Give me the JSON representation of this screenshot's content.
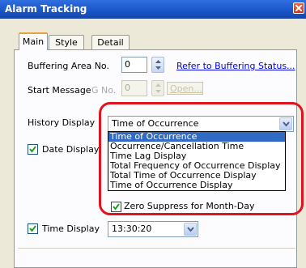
{
  "window": {
    "title": "Alarm Tracking"
  },
  "tabs": [
    {
      "label": "Main",
      "active": true
    },
    {
      "label": "Style",
      "active": false
    },
    {
      "label": "Detail",
      "active": false
    }
  ],
  "buffering": {
    "label": "Buffering Area No.",
    "value": "0",
    "link": "Refer to Buffering Status..."
  },
  "start_message": {
    "label": "Start Message",
    "gno_label": "G No.",
    "value": "0",
    "open_label": "Open..."
  },
  "history": {
    "label": "History Display",
    "selected": "Time of Occurrence",
    "options": [
      "Time of Occurrence",
      "Occurrence/Cancellation Time",
      "Time Lag Display",
      "Total Frequency of Occurrence Display",
      "Total Time of Occurrence Display",
      "Time of Occurrence Display"
    ]
  },
  "date_display": {
    "label": "Date Display",
    "checked": true
  },
  "zero_suppress": {
    "label": "Zero Suppress for Month-Day",
    "checked": true
  },
  "time_display": {
    "label": "Time Display",
    "checked": true,
    "selected": "13:30:20"
  },
  "colors": {
    "accent": "#316ac5",
    "highlight": "#e0141e",
    "titlebar": "#1a56c7"
  }
}
